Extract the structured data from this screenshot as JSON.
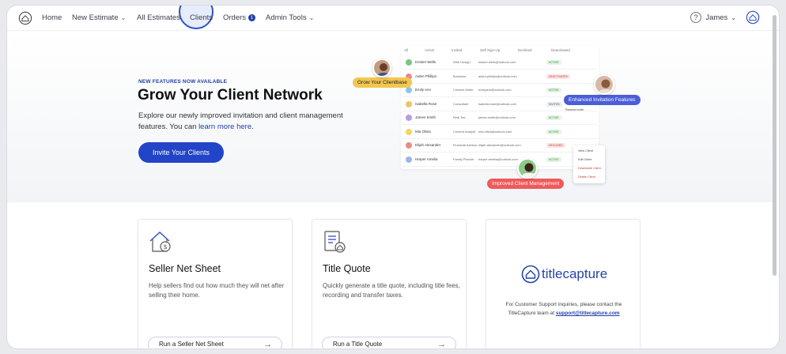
{
  "nav": {
    "items": [
      {
        "label": "Home",
        "chevron": false
      },
      {
        "label": "New Estimate",
        "chevron": true
      },
      {
        "label": "All Estimates",
        "chevron": false
      },
      {
        "label": "Clients",
        "chevron": false
      },
      {
        "label": "Orders",
        "chevron": false,
        "badge": "1"
      },
      {
        "label": "Admin Tools",
        "chevron": true
      }
    ],
    "help_icon": "?",
    "user_name": "James",
    "accent": "#2244c6"
  },
  "hero": {
    "eyebrow": "NEW FEATURES NOW AVAILABLE",
    "title": "Grow Your Client Network",
    "desc_before": "Explore our newly improved invitation and client management features. You can ",
    "desc_link": "learn more here",
    "desc_after": ".",
    "button": "Invite Your Clients",
    "mock": {
      "tabs": [
        "All",
        "Active",
        "Invited",
        "Self Sign-Up",
        "Declined",
        "Deactivated"
      ],
      "rows": [
        {
          "name": "Kristen Wells",
          "role": "Web Design",
          "email": "kristen.wells@outlook.com",
          "status": "ACTIVE",
          "color": "#7bc67e"
        },
        {
          "name": "Aiden Phillips",
          "role": "Business",
          "email": "aiden.phillips@outlook.com",
          "status": "DEACTIVATED",
          "color": "#e88b8b"
        },
        {
          "name": "Emily Ann",
          "role": "Content Writer",
          "email": "emilyann@outlook.com",
          "status": "ACTIVE",
          "color": "#8ac6e8"
        },
        {
          "name": "Isabella Rose",
          "role": "Consultant",
          "email": "isabella.rose@outlook.com",
          "status": "INVITED",
          "color": "#f0c36d"
        },
        {
          "name": "James Smith",
          "role": "Real Tax",
          "email": "james.smith@outlook.com",
          "status": "ACTIVE",
          "color": "#b89be0"
        },
        {
          "name": "Mia Olivia",
          "role": "Content Analyst",
          "email": "mia.olivia@outlook.com",
          "status": "ACTIVE",
          "color": "#f3d65e"
        },
        {
          "name": "Elijah Alexander",
          "role": "Financial Advisor",
          "email": "elijah.alexander@outlook.com",
          "status": "DECLINED",
          "color": "#e88b8b"
        },
        {
          "name": "Harper Amelia",
          "role": "Family Planner",
          "email": "harper.amelia@outlook.com",
          "status": "ACTIVE",
          "color": "#9fb4ec"
        }
      ],
      "menu": [
        "View Client",
        "Edit Client",
        "Deactivate Client",
        "Delete Client"
      ],
      "resend": "Resend Invite",
      "pill_grow": "Grow Your Clientbase",
      "pill_invite": "Enhanced Invitation Features",
      "pill_manage": "Improved Client Management"
    }
  },
  "cards": [
    {
      "title": "Seller Net Sheet",
      "desc": "Help sellers find out how much they will net after selling their home.",
      "button": "Run a Seller Net Sheet",
      "icon": "house-dollar-icon"
    },
    {
      "title": "Title Quote",
      "desc": "Quickly generate a title quote, including title fees, recording and transfer taxes.",
      "button": "Run a Title Quote",
      "icon": "document-house-icon"
    },
    {
      "brand": "titlecapture",
      "support_text": "For Customer Support inquiries, please contact the TitleCapture team at ",
      "support_email": "support@titlecapture.com"
    }
  ]
}
